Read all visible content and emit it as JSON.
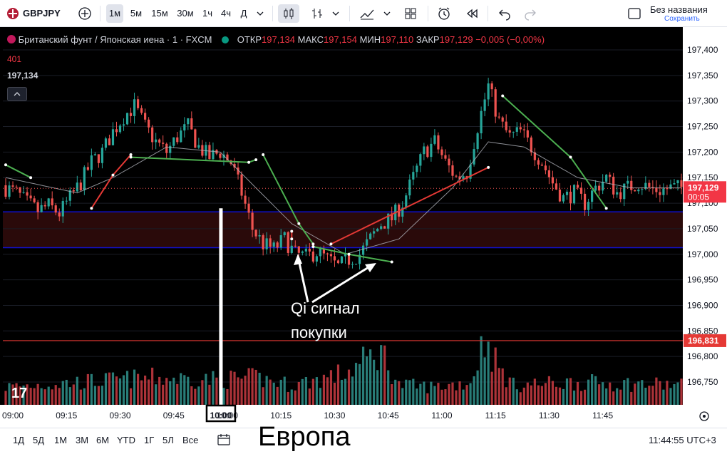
{
  "toolbar": {
    "symbol": "GBPJPY",
    "intervals": [
      "1м",
      "5м",
      "15м",
      "30м",
      "1ч",
      "4ч",
      "Д"
    ],
    "active_interval": "1м",
    "layout_name": "Без названия",
    "save_label": "Сохранить"
  },
  "legend": {
    "instrument": "Британский фунт / Японская иена · 1 · FXCM",
    "open_label": "ОТКР",
    "open_value": "197,134",
    "high_label": "МАКС",
    "high_value": "197,154",
    "low_label": "МИН",
    "low_value": "197,110",
    "close_label": "ЗАКР",
    "close_value": "197,129",
    "change_value": "−0,005 (−0,00%)",
    "volume_value": "401",
    "price_value": "197,134"
  },
  "bottombar": {
    "ranges": [
      "1Д",
      "5Д",
      "1М",
      "3М",
      "6М",
      "YTD",
      "1Г",
      "5Л",
      "Все"
    ],
    "clock": "11:44:55 UTC+3"
  },
  "annotations": {
    "signal_line1": "Qi сигнал",
    "signal_line2": "покупки",
    "session_label": "Европа",
    "session_time": "10:00"
  },
  "colors": {
    "up": "#26a69a",
    "down": "#ef5350",
    "up_volume": "#2e8b85",
    "down_volume": "#c0393f",
    "support_line": "#1010d0",
    "level_line": "#e53935",
    "zone_fill": "#2a0a0a",
    "bg": "#000000"
  },
  "chart_data": {
    "type": "candlestick",
    "symbol": "GBPJPY",
    "timeframe": "1m",
    "ylim": [
      196.7,
      197.42
    ],
    "y_ticks": [
      "197,400",
      "197,350",
      "197,300",
      "197,250",
      "197,200",
      "197,150",
      "197,100",
      "197,050",
      "197,000",
      "196,950",
      "196,900",
      "196,850",
      "196,800",
      "196,750"
    ],
    "x_ticks": [
      "09:00",
      "09:15",
      "09:30",
      "09:45",
      "10:00",
      "10:15",
      "10:30",
      "10:45",
      "11:00",
      "11:15",
      "11:30",
      "11:45"
    ],
    "current_price": "197,129",
    "current_countdown": "00:05",
    "level_price": "196,831",
    "zone": [
      197.013,
      197.083
    ],
    "close_path": [
      [
        0,
        197.13
      ],
      [
        3,
        197.12
      ],
      [
        6,
        197.1
      ],
      [
        9,
        197.085
      ],
      [
        12,
        197.095
      ],
      [
        15,
        197.08
      ],
      [
        18,
        197.11
      ],
      [
        21,
        197.14
      ],
      [
        24,
        197.18
      ],
      [
        27,
        197.2
      ],
      [
        30,
        197.24
      ],
      [
        33,
        197.27
      ],
      [
        36,
        197.29
      ],
      [
        39,
        197.25
      ],
      [
        42,
        197.22
      ],
      [
        45,
        197.2
      ],
      [
        48,
        197.23
      ],
      [
        51,
        197.25
      ],
      [
        54,
        197.21
      ],
      [
        57,
        197.19
      ],
      [
        60,
        197.2
      ],
      [
        63,
        197.18
      ],
      [
        66,
        197.12
      ],
      [
        69,
        197.05
      ],
      [
        72,
        197.02
      ],
      [
        75,
        197.01
      ],
      [
        78,
        197.03
      ],
      [
        81,
        197.0
      ],
      [
        84,
        196.995
      ],
      [
        87,
        197.005
      ],
      [
        90,
        196.99
      ],
      [
        93,
        196.975
      ],
      [
        96,
        196.99
      ],
      [
        99,
        197.0
      ],
      [
        102,
        197.03
      ],
      [
        105,
        197.06
      ],
      [
        108,
        197.07
      ],
      [
        111,
        197.1
      ],
      [
        114,
        197.15
      ],
      [
        117,
        197.2
      ],
      [
        120,
        197.22
      ],
      [
        123,
        197.18
      ],
      [
        126,
        197.15
      ],
      [
        129,
        197.16
      ],
      [
        132,
        197.25
      ],
      [
        135,
        197.33
      ],
      [
        138,
        197.26
      ],
      [
        141,
        197.23
      ],
      [
        144,
        197.24
      ],
      [
        147,
        197.21
      ],
      [
        150,
        197.18
      ],
      [
        153,
        197.14
      ],
      [
        156,
        197.11
      ],
      [
        159,
        197.12
      ],
      [
        162,
        197.1
      ],
      [
        165,
        197.13
      ],
      [
        168,
        197.15
      ],
      [
        171,
        197.12
      ],
      [
        174,
        197.13
      ],
      [
        177,
        197.14
      ],
      [
        180,
        197.13
      ],
      [
        183,
        197.125
      ],
      [
        186,
        197.13
      ],
      [
        189,
        197.13
      ]
    ],
    "volume_profile": [
      [
        0,
        0.2
      ],
      [
        20,
        0.25
      ],
      [
        40,
        0.3
      ],
      [
        60,
        0.28
      ],
      [
        70,
        0.3
      ],
      [
        80,
        0.22
      ],
      [
        95,
        0.35
      ],
      [
        105,
        0.6
      ],
      [
        110,
        0.22
      ],
      [
        120,
        0.2
      ],
      [
        130,
        0.25
      ],
      [
        134,
        0.75
      ],
      [
        138,
        0.4
      ],
      [
        142,
        0.22
      ],
      [
        160,
        0.25
      ],
      [
        189,
        0.22
      ]
    ],
    "ma_path": [
      [
        0,
        197.15
      ],
      [
        20,
        197.12
      ],
      [
        30,
        197.15
      ],
      [
        45,
        197.21
      ],
      [
        60,
        197.2
      ],
      [
        70,
        197.13
      ],
      [
        80,
        197.06
      ],
      [
        95,
        197.0
      ],
      [
        110,
        197.03
      ],
      [
        125,
        197.13
      ],
      [
        135,
        197.22
      ],
      [
        145,
        197.21
      ],
      [
        160,
        197.15
      ],
      [
        175,
        197.13
      ],
      [
        189,
        197.13
      ]
    ],
    "zigzag": [
      {
        "color": "#4caf50",
        "points": [
          [
            0,
            197.175
          ],
          [
            7,
            197.15
          ]
        ]
      },
      {
        "color": "#e53935",
        "points": [
          [
            24,
            197.09
          ],
          [
            30,
            197.155
          ],
          [
            35,
            197.195
          ]
        ]
      },
      {
        "color": "#4caf50",
        "points": [
          [
            35,
            197.19
          ],
          [
            68,
            197.18
          ],
          [
            70,
            197.185
          ]
        ]
      },
      {
        "color": "#4caf50",
        "points": [
          [
            72,
            197.195
          ],
          [
            82,
            197.06
          ],
          [
            86,
            197.02
          ]
        ]
      },
      {
        "color": "#e53935",
        "points": [
          [
            80,
            197.03
          ],
          [
            80,
            197.045
          ]
        ]
      },
      {
        "color": "#4caf50",
        "points": [
          [
            86,
            197.015
          ],
          [
            96,
            197.0
          ],
          [
            108,
            196.985
          ]
        ]
      },
      {
        "color": "#e53935",
        "points": [
          [
            91,
            197.02
          ],
          [
            135,
            197.17
          ]
        ]
      },
      {
        "color": "#4caf50",
        "points": [
          [
            139,
            197.31
          ],
          [
            158,
            197.19
          ],
          [
            168,
            197.09
          ]
        ]
      }
    ]
  }
}
